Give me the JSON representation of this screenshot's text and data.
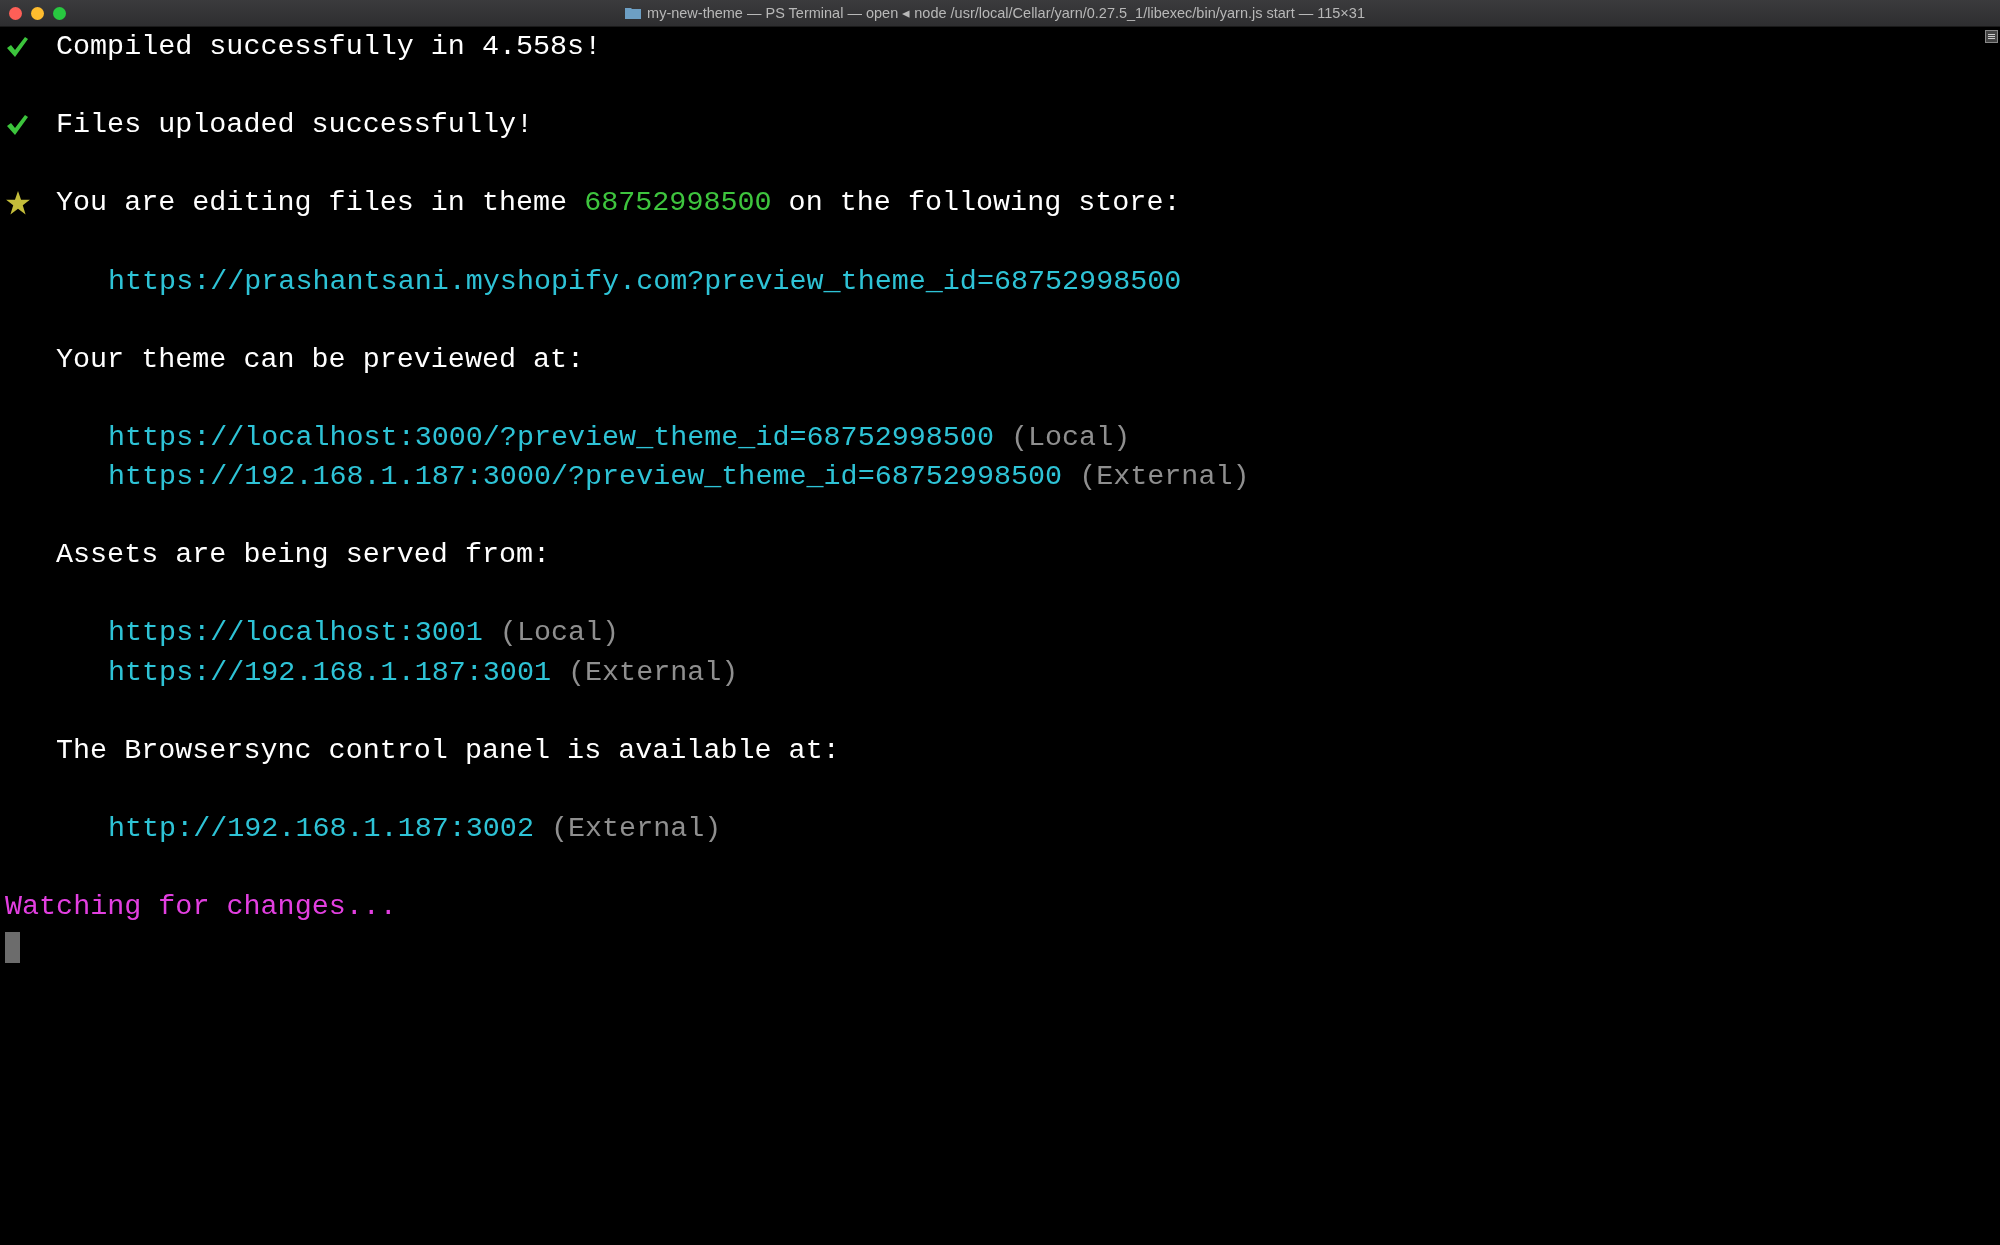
{
  "window": {
    "title": "my-new-theme — PS Terminal — open ◂ node /usr/local/Cellar/yarn/0.27.5_1/libexec/bin/yarn.js start — 115×31"
  },
  "lines": [
    {
      "kind": "success",
      "segments": [
        {
          "kind": "plain",
          "text": "Compiled successfully in 4.558s!"
        }
      ]
    },
    {
      "kind": "blank"
    },
    {
      "kind": "success",
      "segments": [
        {
          "kind": "plain",
          "text": "Files uploaded successfully!"
        }
      ]
    },
    {
      "kind": "blank"
    },
    {
      "kind": "notice",
      "segments": [
        {
          "kind": "plain",
          "text": "You are editing files in theme "
        },
        {
          "kind": "id",
          "text": "68752998500"
        },
        {
          "kind": "plain",
          "text": " on the following store:"
        }
      ]
    },
    {
      "kind": "blank"
    },
    {
      "kind": "indented",
      "segments": [
        {
          "kind": "url",
          "text": "https://prashantsani.myshopify.com?preview_theme_id=68752998500"
        }
      ]
    },
    {
      "kind": "blank"
    },
    {
      "kind": "output",
      "segments": [
        {
          "kind": "plain",
          "text": "Your theme can be previewed at:"
        }
      ]
    },
    {
      "kind": "blank"
    },
    {
      "kind": "indented",
      "segments": [
        {
          "kind": "url",
          "text": "https://localhost:3000/?preview_theme_id=68752998500"
        },
        {
          "kind": "note",
          "text": " (Local)"
        }
      ]
    },
    {
      "kind": "indented",
      "segments": [
        {
          "kind": "url",
          "text": "https://192.168.1.187:3000/?preview_theme_id=68752998500"
        },
        {
          "kind": "note",
          "text": " (External)"
        }
      ]
    },
    {
      "kind": "blank"
    },
    {
      "kind": "output",
      "segments": [
        {
          "kind": "plain",
          "text": "Assets are being served from:"
        }
      ]
    },
    {
      "kind": "blank"
    },
    {
      "kind": "indented",
      "segments": [
        {
          "kind": "url",
          "text": "https://localhost:3001"
        },
        {
          "kind": "note",
          "text": " (Local)"
        }
      ]
    },
    {
      "kind": "indented",
      "segments": [
        {
          "kind": "url",
          "text": "https://192.168.1.187:3001"
        },
        {
          "kind": "note",
          "text": " (External)"
        }
      ]
    },
    {
      "kind": "blank"
    },
    {
      "kind": "output",
      "segments": [
        {
          "kind": "plain",
          "text": "The Browsersync control panel is available at:"
        }
      ]
    },
    {
      "kind": "blank"
    },
    {
      "kind": "indented",
      "segments": [
        {
          "kind": "url",
          "text": "http://192.168.1.187:3002"
        },
        {
          "kind": "note",
          "text": " (External)"
        }
      ]
    },
    {
      "kind": "blank"
    },
    {
      "kind": "flush",
      "segments": [
        {
          "kind": "watch",
          "text": "Watching for changes..."
        }
      ]
    },
    {
      "kind": "cursor"
    }
  ]
}
